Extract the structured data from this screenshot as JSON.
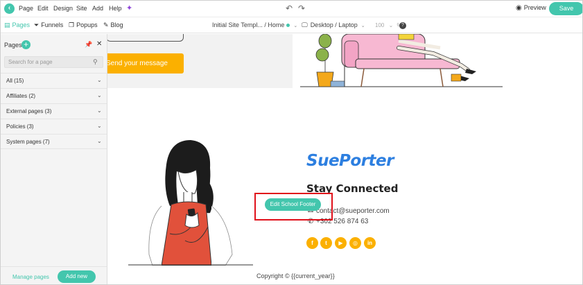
{
  "menubar": {
    "items": [
      "Page",
      "Edit",
      "Design",
      "Site",
      "Add",
      "Help"
    ],
    "preview_label": "Preview",
    "save_label": "Save"
  },
  "toolbar": {
    "tabs": [
      "Pages",
      "Funnels",
      "Popups",
      "Blog"
    ],
    "page_selector": "Initial Site Templ... / Home",
    "device_selector": "Desktop / Laptop",
    "zoom_value": "100",
    "zoom_unit": "%"
  },
  "pages_panel": {
    "title": "Pages",
    "search_placeholder": "Search for a page",
    "categories": [
      "All (15)",
      "Affiliates (2)",
      "External pages (3)",
      "Policies (3)",
      "System pages (7)"
    ],
    "manage_label": "Manage pages",
    "add_new_label": "Add new"
  },
  "canvas": {
    "send_button": "Send your message",
    "brand": "SuePorter",
    "heading": "Stay Connected",
    "email": "contact@sueporter.com",
    "phone": "+302 526 874 63",
    "socials": [
      "f",
      "t",
      "▶",
      "◎",
      "in"
    ],
    "edit_footer_label": "Edit School Footer",
    "copyright": "Copyright © {{current_year}}"
  },
  "colors": {
    "accent": "#43c6ad",
    "brand_blue": "#2d7fe0",
    "cta_orange": "#fbb000",
    "highlight_red": "#e0101a"
  }
}
